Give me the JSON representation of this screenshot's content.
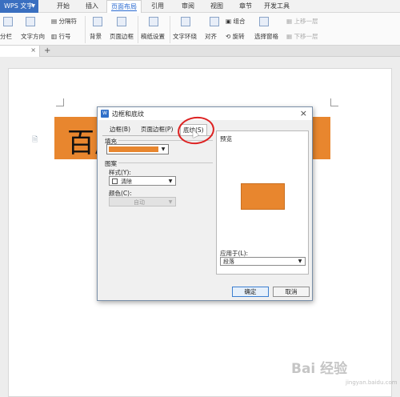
{
  "app": {
    "button_label": "WPS 文字"
  },
  "menu": {
    "tabs": [
      "开始",
      "插入",
      "页面布局",
      "引用",
      "审阅",
      "视图",
      "章节",
      "开发工具"
    ],
    "active": "页面布局"
  },
  "ribbon": {
    "columns": "分栏",
    "text_direction": "文字方向",
    "separator": "分隔符",
    "line_number": "行号",
    "background": "背景",
    "page_border": "页面边框",
    "paper_settings": "稿纸设置",
    "text_wrap": "文字环绕",
    "align": "对齐",
    "group": "组合",
    "rotate": "旋转",
    "selection_pane": "选择窗格",
    "bring_forward": "上移一层",
    "send_backward": "下移一层"
  },
  "document": {
    "big_text": "百度"
  },
  "dialog": {
    "title": "边框和底纹",
    "tabs": [
      "边框(B)",
      "页面边框(P)",
      "底纹(S)"
    ],
    "active_tab": "底纹(S)",
    "fill_label": "填充",
    "fill_color": "#e8862e",
    "pattern_label": "图案",
    "style_label": "样式(Y):",
    "style_value": "清除",
    "color_label": "颜色(C):",
    "color_value": "自动",
    "preview_label": "预览",
    "apply_label": "应用于(L):",
    "apply_value": "段落",
    "ok": "确定",
    "cancel": "取消"
  },
  "watermark": {
    "main": "Bai 经验",
    "sub": "jingyan.baidu.com"
  }
}
